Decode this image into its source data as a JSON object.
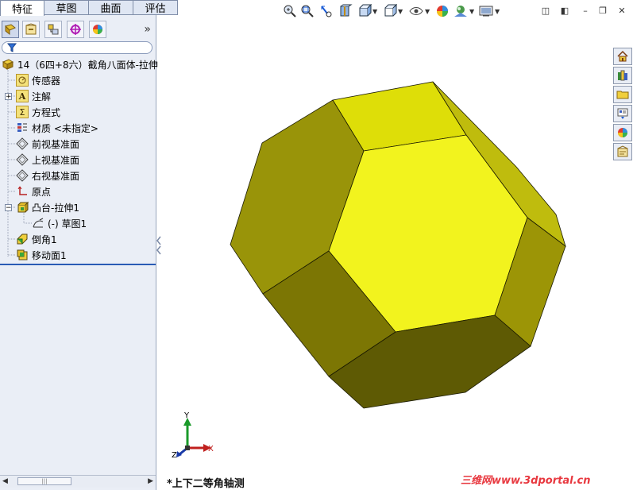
{
  "tabs": [
    {
      "label": "特征"
    },
    {
      "label": "草图"
    },
    {
      "label": "曲面"
    },
    {
      "label": "评估"
    }
  ],
  "panel_toolbar": {
    "icons": [
      "feature-manager-icon",
      "property-manager-icon",
      "configuration-manager-icon",
      "dimxpert-icon",
      "display-manager-icon"
    ],
    "expand_glyph": "»"
  },
  "filter": {
    "icon": "filter-icon",
    "value": ""
  },
  "tree": {
    "root": "14（6四+8六）截角八面体-拉伸",
    "items": [
      {
        "label": "传感器",
        "icon": "sensors-icon"
      },
      {
        "label": "注解",
        "icon": "annotations-icon"
      },
      {
        "label": "方程式",
        "icon": "equations-icon"
      },
      {
        "label": "材质 <未指定>",
        "icon": "material-icon"
      },
      {
        "label": "前视基准面",
        "icon": "plane-icon"
      },
      {
        "label": "上视基准面",
        "icon": "plane-icon"
      },
      {
        "label": "右视基准面",
        "icon": "plane-icon"
      },
      {
        "label": "原点",
        "icon": "origin-icon"
      },
      {
        "label": "凸台-拉伸1",
        "icon": "boss-extrude-icon"
      },
      {
        "label": "(-) 草图1",
        "icon": "sketch-icon"
      },
      {
        "label": "倒角1",
        "icon": "chamfer-icon"
      },
      {
        "label": "移动面1",
        "icon": "move-face-icon"
      }
    ]
  },
  "view_toolbar": {
    "icons": [
      "zoom-to-fit-icon",
      "zoom-area-icon",
      "previous-view-icon",
      "section-view-icon",
      "view-orientation-icon",
      "display-style-icon",
      "hide-show-icon",
      "edit-appearance-icon",
      "apply-scene-icon",
      "view-settings-icon"
    ]
  },
  "window_controls": {
    "icons": [
      "tile-left-icon",
      "tile-right-icon",
      "minimize-icon",
      "restore-icon",
      "close-icon"
    ],
    "glyphs": [
      "◫",
      "◧",
      "–",
      "❐",
      "✕"
    ]
  },
  "task_pane": {
    "icons": [
      "home-icon",
      "library-icon",
      "file-explorer-icon",
      "view-palette-icon",
      "appearances-icon",
      "custom-properties-icon"
    ]
  },
  "triad": {
    "x": "X",
    "y": "Y",
    "z": "Z"
  },
  "view_name": "*上下二等角轴测",
  "watermark": "三维网www.3dportal.cn",
  "colors": {
    "model_front_face": "#f2f31e",
    "model_top_face": "#dede08",
    "model_left_face": "#9a9400",
    "model_dark_face": "#5e5a04",
    "selection_bar": "#2a5bb5",
    "watermark": "#e8383f"
  }
}
